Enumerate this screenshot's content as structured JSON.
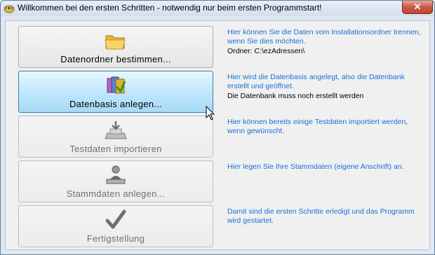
{
  "window": {
    "title": "Willkommen bei den ersten Schritten - notwendig nur beim ersten Programmstart!",
    "close_label": "✕"
  },
  "steps": [
    {
      "label": "Datenordner bestimmen...",
      "icon": "folder-icon",
      "state": "enabled",
      "description": "Hier können Sie die Daten vom Installationsordner trennen, wenn Sie dies möchten.",
      "status": "Ordner: C:\\ezAdressen\\"
    },
    {
      "label": "Datenbasis anlegen...",
      "icon": "database-book-icon",
      "state": "hover",
      "description": "Hier wird die Datenbasis angelegt, also die Datenbank erstellt und geöffnet.",
      "status": "Die Datenbank muss noch erstellt werden"
    },
    {
      "label": "Testdaten importieren",
      "icon": "import-tray-icon",
      "state": "disabled",
      "description": "Hier können bereits einige Testdaten importiert werden, wenn gewünscht.",
      "status": ""
    },
    {
      "label": "Stammdaten anlegen...",
      "icon": "person-desk-icon",
      "state": "disabled",
      "description": "Hier legen Sie Ihre Stammdaten (eigene Anschrift) an.",
      "status": ""
    },
    {
      "label": "Fertigstellung",
      "icon": "checkmark-icon",
      "state": "disabled",
      "description": "Damit sind die ersten Schritte erledigt und das Programm wird gestartet.",
      "status": ""
    }
  ],
  "colors": {
    "description_text": "#1a6fd8",
    "hover_button": "#bde6fd",
    "disabled_text": "#6f6f6f"
  }
}
